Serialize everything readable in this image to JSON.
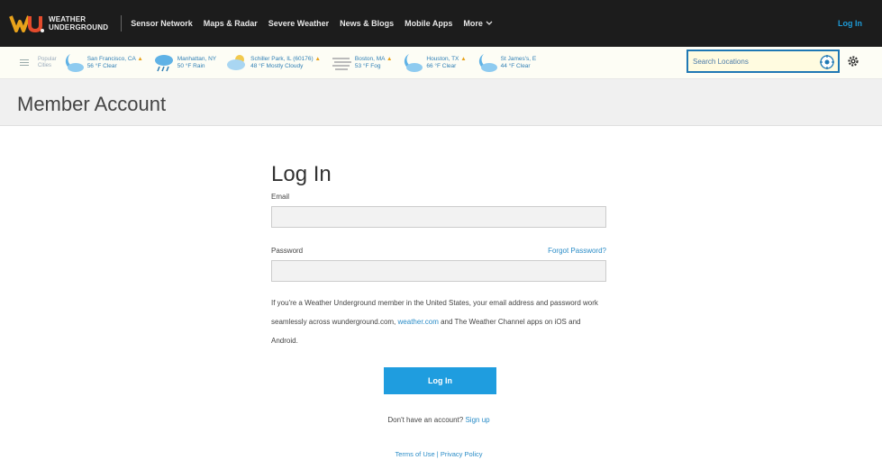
{
  "nav": {
    "logo_line1": "WEATHER",
    "logo_line2": "UNDERGROUND",
    "links": [
      "Sensor Network",
      "Maps & Radar",
      "Severe Weather",
      "News & Blogs",
      "Mobile Apps",
      "More"
    ],
    "login": "Log In"
  },
  "locations": {
    "popular_line1": "Popular",
    "popular_line2": "Cities",
    "items": [
      {
        "name": "San Francisco, CA",
        "cond": "56 °F Clear",
        "warn": true,
        "icon": "moon-cloud-icon"
      },
      {
        "name": "Manhattan, NY",
        "cond": "50 °F Rain",
        "warn": false,
        "icon": "rain-cloud-icon"
      },
      {
        "name": "Schiller Park, IL (60176)",
        "cond": "48 °F Mostly Cloudy",
        "warn": true,
        "icon": "cloud-icon"
      },
      {
        "name": "Boston, MA",
        "cond": "53 °F Fog",
        "warn": true,
        "icon": "fog-icon"
      },
      {
        "name": "Houston, TX",
        "cond": "66 °F Clear",
        "warn": true,
        "icon": "moon-cloud-icon"
      },
      {
        "name": "St James's, E",
        "cond": "44 °F Clear",
        "warn": false,
        "icon": "moon-cloud-icon"
      }
    ],
    "search_placeholder": "Search Locations"
  },
  "page": {
    "title": "Member Account"
  },
  "form": {
    "title": "Log In",
    "email_label": "Email",
    "password_label": "Password",
    "forgot": "Forgot Password?",
    "info_part1": "If you're a Weather Underground member in the United States, your email address and password work seamlessly across wunderground.com,",
    "info_link": "weather.com",
    "info_part2": " and The Weather Channel apps on iOS and Android.",
    "login_button": "Log In",
    "signup_prompt": "Don't have an account?",
    "signup_link": "Sign up",
    "terms": "Terms of Use",
    "privacy": "Privacy Policy",
    "sep": " | "
  },
  "colors": {
    "nav_bg": "#1c1c1c",
    "accent": "#1f9ddf",
    "link": "#2a8cc7"
  }
}
